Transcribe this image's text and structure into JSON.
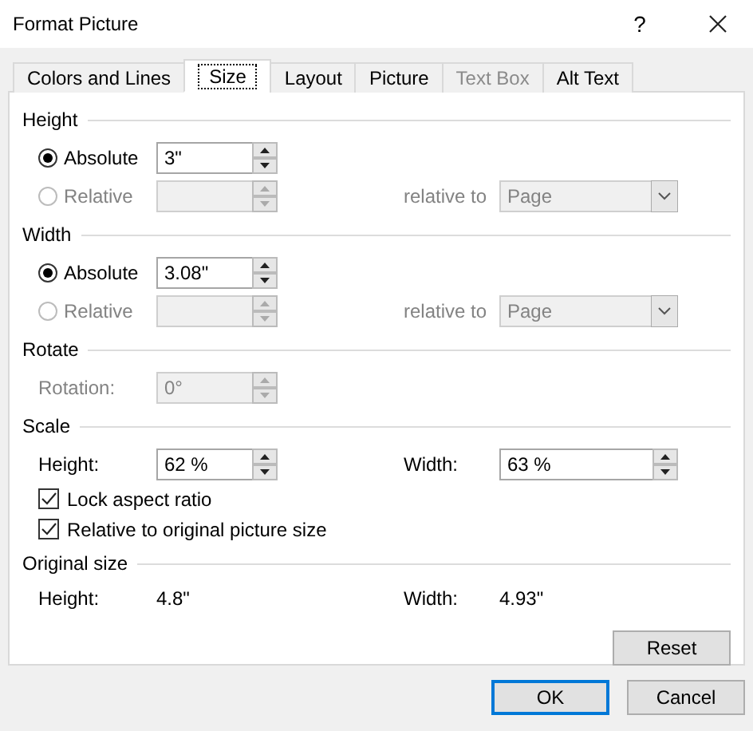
{
  "window": {
    "title": "Format Picture",
    "help": "?"
  },
  "tabs": [
    {
      "label": "Colors and Lines",
      "selected": false,
      "disabled": false
    },
    {
      "label": "Size",
      "selected": true,
      "disabled": false
    },
    {
      "label": "Layout",
      "selected": false,
      "disabled": false
    },
    {
      "label": "Picture",
      "selected": false,
      "disabled": false
    },
    {
      "label": "Text Box",
      "selected": false,
      "disabled": true
    },
    {
      "label": "Alt Text",
      "selected": false,
      "disabled": false
    }
  ],
  "sections": [
    {
      "kind": "size",
      "title": "Height",
      "options": [
        {
          "label": "Absolute",
          "selected": true,
          "disabled": false,
          "value": "3\""
        },
        {
          "label": "Relative",
          "selected": false,
          "disabled": true
        }
      ],
      "relative_to": {
        "label": "relative to",
        "value": "Page",
        "disabled": true
      }
    },
    {
      "kind": "size",
      "title": "Width",
      "options": [
        {
          "label": "Absolute",
          "selected": true,
          "disabled": false,
          "value": "3.08\""
        },
        {
          "label": "Relative",
          "selected": false,
          "disabled": true
        }
      ],
      "relative_to": {
        "label": "relative to",
        "value": "Page",
        "disabled": true
      }
    },
    {
      "kind": "rotate",
      "title": "Rotate",
      "field": {
        "label": "Rotation:",
        "value": "0°",
        "disabled": true
      }
    },
    {
      "kind": "scale",
      "title": "Scale",
      "fields": [
        {
          "label": "Height:",
          "value": "62 %"
        },
        {
          "label": "Width:",
          "value": "63 %"
        }
      ],
      "checkboxes": [
        {
          "label": "Lock aspect ratio",
          "checked": true
        },
        {
          "label": "Relative to original picture size",
          "checked": true
        }
      ]
    },
    {
      "kind": "original",
      "title": "Original size",
      "pairs": [
        {
          "label": "Height:",
          "value": "4.8\""
        },
        {
          "label": "Width:",
          "value": "4.93\""
        }
      ],
      "reset": "Reset"
    }
  ],
  "buttons": [
    {
      "label": "OK",
      "default": true
    },
    {
      "label": "Cancel",
      "default": false
    }
  ]
}
